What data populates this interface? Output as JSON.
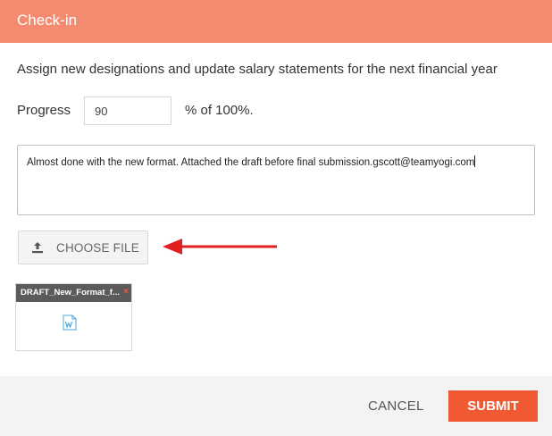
{
  "dialog": {
    "title": "Check-in"
  },
  "task": {
    "description": "Assign new designations and update salary statements for the next financial year"
  },
  "progress": {
    "label": "Progress",
    "value": "90",
    "suffix": "% of 100%."
  },
  "comment": {
    "text": "Almost done with the new format. Attached the draft before final submission.gscott@teamyogi.com"
  },
  "upload": {
    "button_label": "CHOOSE FILE",
    "icon": "upload-icon"
  },
  "attachment": {
    "file_name": "DRAFT_New_Format_f...",
    "remove_icon": "×",
    "file_icon": "word-document-icon"
  },
  "footer": {
    "cancel_label": "CANCEL",
    "submit_label": "SUBMIT"
  },
  "colors": {
    "header": "#f48b70",
    "submit": "#f05a33",
    "arrow": "#e02020",
    "word_icon": "#4aa8d8"
  }
}
